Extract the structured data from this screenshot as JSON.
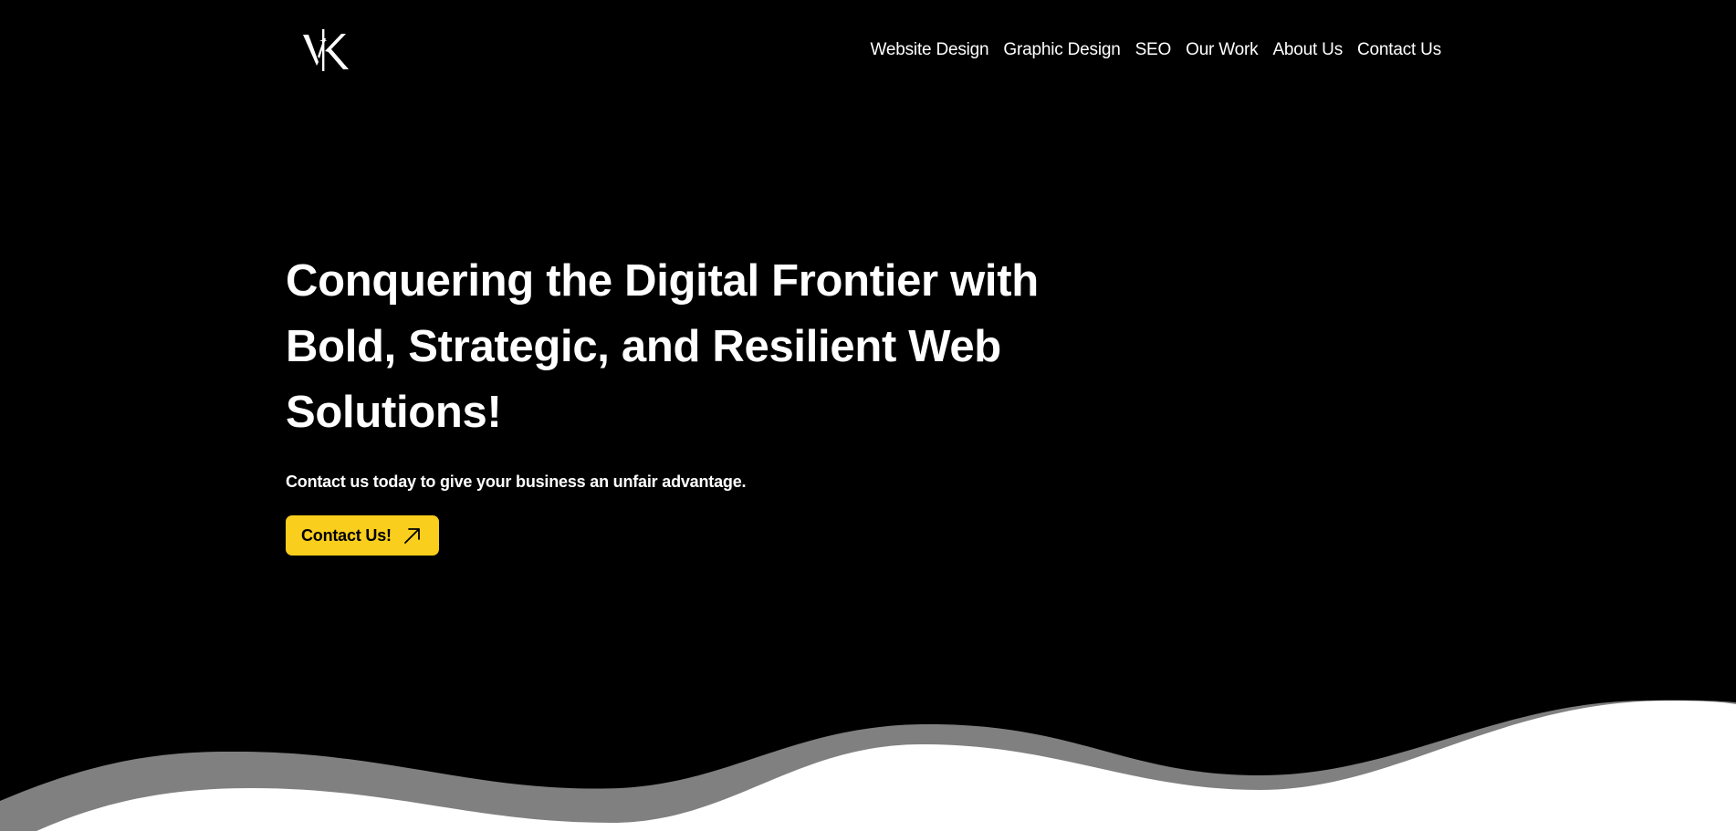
{
  "logo": {
    "icon": "vk-monogram-logo",
    "letters": "VK"
  },
  "nav": {
    "items": [
      {
        "label": "Website Design"
      },
      {
        "label": "Graphic Design"
      },
      {
        "label": "SEO"
      },
      {
        "label": "Our Work"
      },
      {
        "label": "About Us"
      },
      {
        "label": "Contact Us"
      }
    ]
  },
  "hero": {
    "heading_lines": [
      "Conquering the Digital Frontier with",
      "Bold, Strategic, and Resilient Web",
      "Solutions!"
    ],
    "subheading": "Contact us today to give your business an unfair advantage.",
    "cta_label": "Contact Us!",
    "cta_icon": "arrow-up-right-icon"
  },
  "colors": {
    "background": "#000000",
    "text": "#ffffff",
    "accent": "#f9ce1c",
    "wave_back": "#808080",
    "wave_front": "#ffffff"
  }
}
